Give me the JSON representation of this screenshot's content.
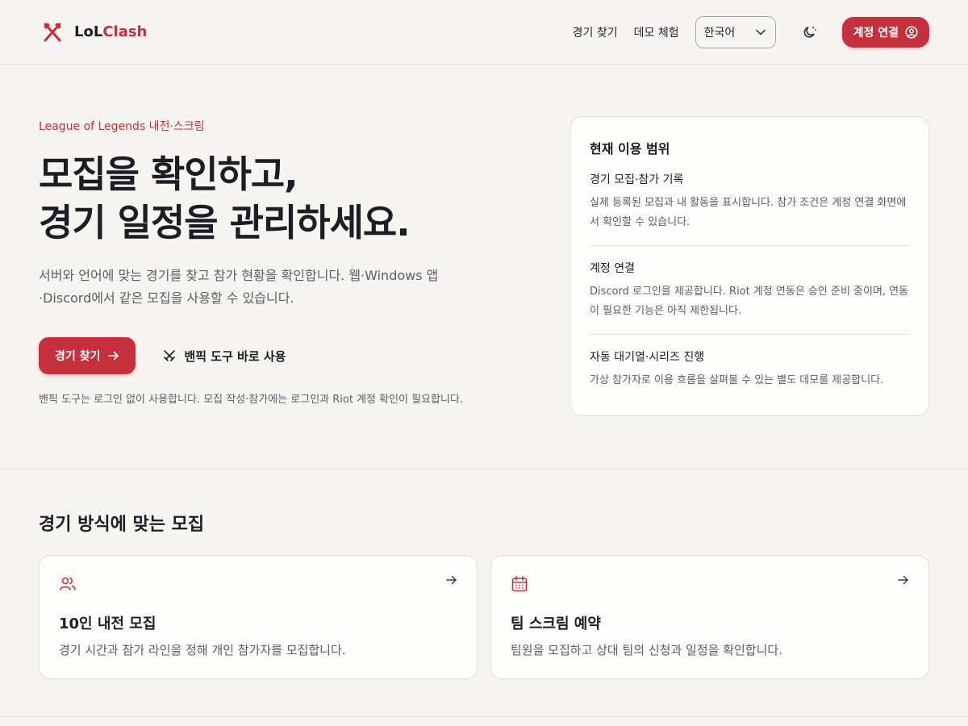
{
  "brand": {
    "name_part1": "LoL",
    "name_part2": "Clash",
    "accent": "#c62f3c"
  },
  "nav": {
    "find_match": "경기 찾기",
    "demo": "데모 체험",
    "language": "한국어",
    "connect": "계정 연결"
  },
  "hero": {
    "eyebrow": "League of Legends 내전·스크림",
    "headline_line1": "모집을 확인하고,",
    "headline_line2": "경기 일정을 관리하세요.",
    "lead": "서버와 언어에 맞는 경기를 찾고 참가 현황을 확인합니다. 웹·Windows 앱 ·Discord에서 같은 모집을 사용할 수 있습니다.",
    "primary_cta": "경기 찾기",
    "secondary_cta": "밴픽 도구 바로 사용",
    "fine_print": "밴픽 도구는 로그인 없이 사용합니다. 모집 작성·참가에는 로그인과 Riot 계정 확인이 필요합니다."
  },
  "scope": {
    "title": "현재 이용 범위",
    "items": [
      {
        "title": "경기 모집·참가 기록",
        "desc": "실제 등록된 모집과 내 활동을 표시합니다. 참가 조건은 계정 연결 화면에서 확인할 수 있습니다."
      },
      {
        "title": "계정 연결",
        "desc": "Discord 로그인을 제공합니다. Riot 계정 연동은 승인 준비 중이며, 연동이 필요한 기능은 아직 제한됩니다."
      },
      {
        "title": "자동 대기열·시리즈 진행",
        "desc": "가상 참가자로 이용 흐름을 살펴볼 수 있는 별도 데모를 제공합니다."
      }
    ]
  },
  "modes": {
    "title": "경기 방식에 맞는 모집",
    "cards": [
      {
        "icon": "users-icon",
        "title": "10인 내전 모집",
        "desc": "경기 시간과 참가 라인을 정해 개인 참가자를 모집합니다."
      },
      {
        "icon": "calendar-icon",
        "title": "팀 스크림 예약",
        "desc": "팀원을 모집하고 상대 팀의 신청과 일정을 확인합니다."
      }
    ]
  }
}
